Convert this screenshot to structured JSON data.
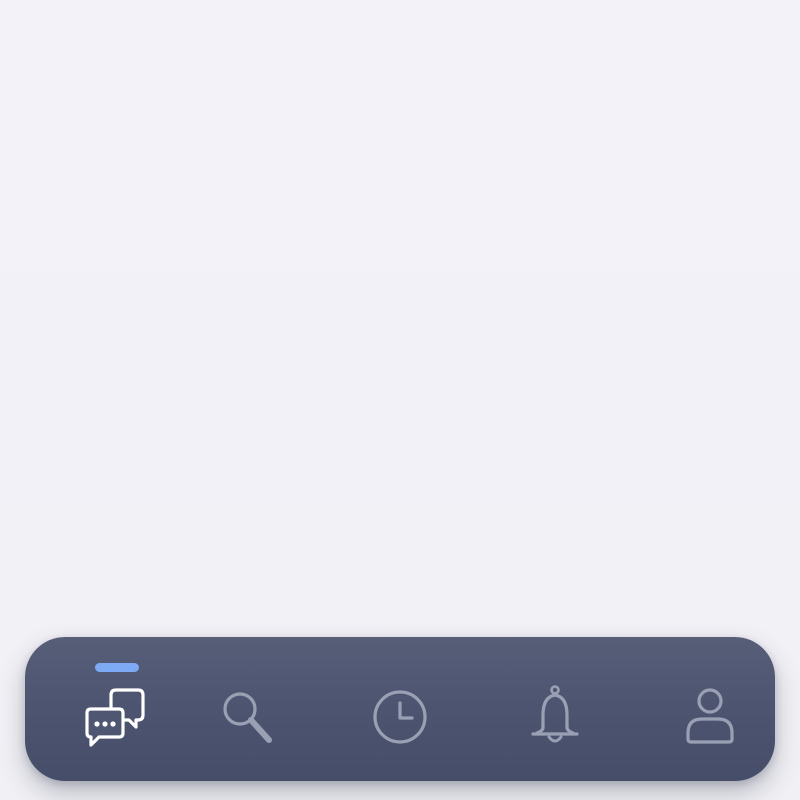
{
  "tab_bar": {
    "active_index": 0,
    "colors": {
      "bar_background": "#4d5470",
      "active_icon": "#ffffff",
      "inactive_icon": "#9aa0b4",
      "active_indicator": "#7ea9f5",
      "page_background": "#f2f1f7"
    },
    "tabs": [
      {
        "id": "chats",
        "icon": "chat-bubbles-icon"
      },
      {
        "id": "search",
        "icon": "search-icon"
      },
      {
        "id": "history",
        "icon": "clock-icon"
      },
      {
        "id": "notifications",
        "icon": "bell-icon"
      },
      {
        "id": "profile",
        "icon": "person-icon"
      }
    ]
  }
}
